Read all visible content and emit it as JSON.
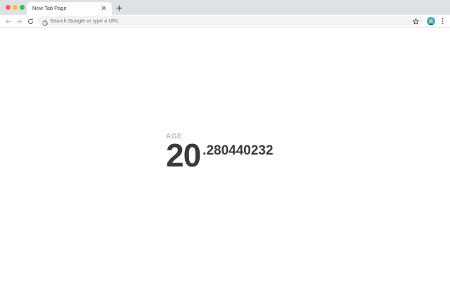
{
  "browser": {
    "tab": {
      "title": "New Tab Page",
      "close_icon": "close-icon"
    },
    "new_tab_icon": "plus-icon",
    "toolbar": {
      "back_icon": "arrow-left-icon",
      "forward_icon": "arrow-right-icon",
      "reload_icon": "reload-icon",
      "omnibox": {
        "placeholder": "Search Google or type a URL",
        "icon": "google-g-icon"
      },
      "bookmark_icon": "star-icon",
      "profile_icon": "avatar",
      "menu_icon": "kebab-menu-icon"
    }
  },
  "age": {
    "label": "AGE",
    "integer": "20",
    "fraction": ".280440232"
  },
  "colors": {
    "tabstrip_bg": "#dee1e6",
    "text_dark": "#3a3a3a",
    "label_gray": "#b3b6b9",
    "avatar_bg": "#3bb6c8"
  }
}
